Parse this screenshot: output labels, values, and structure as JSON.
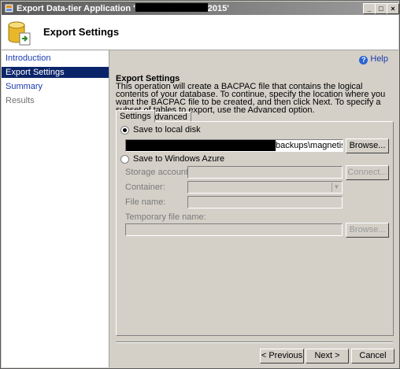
{
  "window": {
    "title_prefix": "Export Data-tier Application '",
    "title_suffix": "2015'",
    "controls": {
      "minimize": "_",
      "maximize": "□",
      "close": "×"
    }
  },
  "header": {
    "title": "Export Settings",
    "icon": "database-export-icon"
  },
  "nav": {
    "items": [
      {
        "label": "Introduction",
        "state": "link"
      },
      {
        "label": "Export Settings",
        "state": "active"
      },
      {
        "label": "Summary",
        "state": "link"
      },
      {
        "label": "Results",
        "state": "disabled"
      }
    ]
  },
  "help": {
    "label": "Help",
    "icon": "help-icon"
  },
  "content": {
    "section_title": "Export Settings",
    "description": "This operation will create a BACPAC file that contains the logical contents of your database. To continue, specify the location where you want the BACPAC file to be created, and then click Next. To specify a subset of tables to export, use the Advanced option."
  },
  "tabs": [
    {
      "label": "Settings",
      "selected": true
    },
    {
      "label": "Advanced",
      "selected": false
    }
  ],
  "settings": {
    "local": {
      "label": "Save to local disk",
      "selected": true,
      "path_value": "backups\\magnetism_wel",
      "browse_label": "Browse..."
    },
    "azure": {
      "label": "Save to Windows Azure",
      "selected": false,
      "storage_account_label": "Storage account:",
      "connect_label": "Connect...",
      "container_label": "Container:",
      "file_name_label": "File name:",
      "temp_file_label": "Temporary file name:",
      "browse_label": "Browse..."
    }
  },
  "footer": {
    "previous_label": "< Previous",
    "next_label": "Next >",
    "cancel_label": "Cancel"
  }
}
